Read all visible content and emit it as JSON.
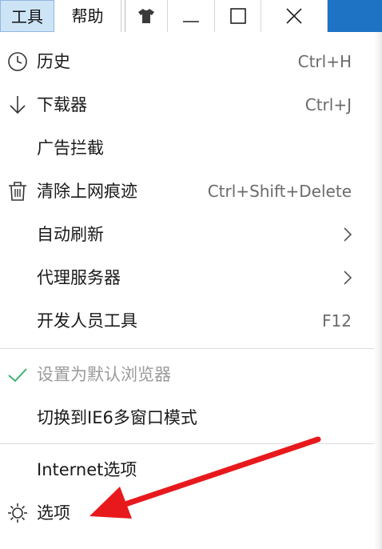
{
  "menubar": {
    "tools_label": "工具",
    "help_label": "帮助"
  },
  "menu": {
    "items": [
      {
        "label": "历史",
        "shortcut": "Ctrl+H",
        "icon": "clock-icon"
      },
      {
        "label": "下载器",
        "shortcut": "Ctrl+J",
        "icon": "download-arrow-icon"
      },
      {
        "label": "广告拦截",
        "shortcut": ""
      },
      {
        "label": "清除上网痕迹",
        "shortcut": "Ctrl+Shift+Delete",
        "icon": "trash-icon"
      },
      {
        "label": "自动刷新",
        "shortcut": "",
        "submenu": true
      },
      {
        "label": "代理服务器",
        "shortcut": "",
        "submenu": true
      },
      {
        "label": "开发人员工具",
        "shortcut": "F12"
      },
      {
        "label": "设置为默认浏览器",
        "shortcut": "",
        "icon": "checkmark-icon",
        "disabled": true
      },
      {
        "label": "切换到IE6多窗口模式",
        "shortcut": ""
      },
      {
        "label": "Internet选项",
        "shortcut": ""
      },
      {
        "label": "选项",
        "shortcut": "",
        "icon": "gear-icon"
      }
    ]
  },
  "colors": {
    "active_menu_bg": "#cde4f7",
    "check_green": "#3cb371",
    "annotation_arrow": "#e8191c",
    "title_blue": "#1f73c4"
  }
}
